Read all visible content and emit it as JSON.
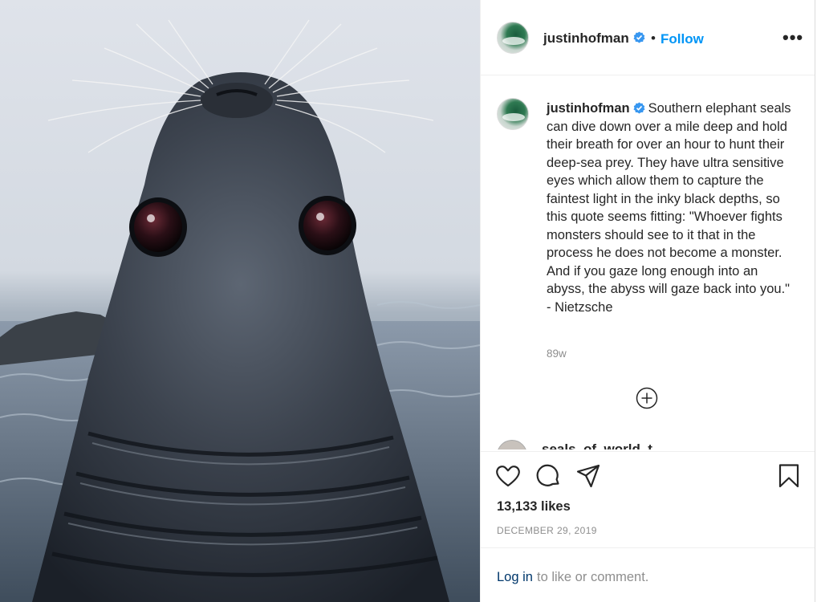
{
  "post": {
    "photo_alt": "",
    "author": {
      "username": "justinhofman",
      "verified_icon": "verified-badge-icon",
      "avatar_icon": "avatar"
    },
    "header": {
      "separator": "•",
      "follow_label": "Follow",
      "more_label": "•••"
    },
    "caption": {
      "username": "justinhofman",
      "text": "Southern elephant seals can dive down over a mile deep and hold their breath for over an hour to hunt their deep-sea prey. They have ultra sensitive eyes which allow them to capture the faintest light in the inky black depths, so this quote seems fitting: \"Whoever fights monsters should see to it that in the process he does not become a monster. And if you gaze long enough into an abyss, the abyss will gaze back into you.\" - Nietzsche",
      "time_ago": "89w"
    },
    "load_more_icon": "plus-circle-icon",
    "cutoff_comment": "seals_of_world_t..._",
    "actions": {
      "like_icon": "heart-icon",
      "comment_icon": "comment-icon",
      "share_icon": "send-icon",
      "save_icon": "bookmark-icon"
    },
    "likes": "13,133 likes",
    "date": "DECEMBER 29, 2019",
    "login": {
      "link": "Log in",
      "rest": "to like or comment."
    }
  },
  "colors": {
    "link_blue": "#0095f6",
    "verified_blue": "#3897f0",
    "text": "#262626",
    "muted": "#8e8e8e"
  }
}
